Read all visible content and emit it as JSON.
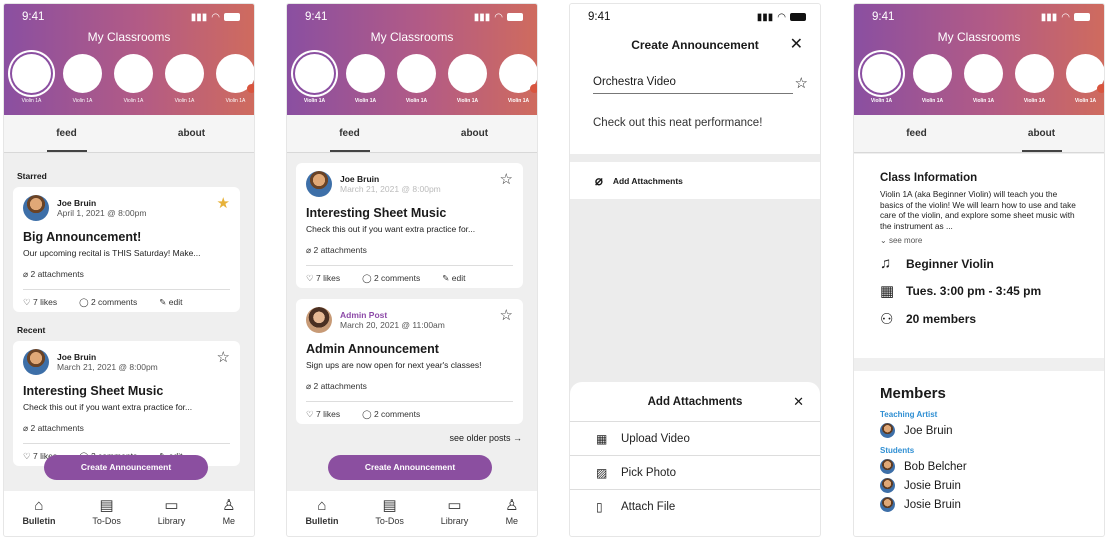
{
  "status": {
    "time": "9:41",
    "signal": ".ııl",
    "wifi": "≋"
  },
  "header": {
    "title": "My Classrooms",
    "class_label": "Violin 1A"
  },
  "tabs": {
    "feed": "feed",
    "about": "about"
  },
  "screen1": {
    "starred_title": "Starred",
    "recent_title": "Recent",
    "post1": {
      "author": "Joe Bruin",
      "date": "April 1, 2021 @ 8:00pm",
      "title": "Big Announcement!",
      "body": "Our upcoming recital is THIS Saturday! Make...",
      "attachments": "2 attachments",
      "likes": "7 likes",
      "comments": "2 comments",
      "edit": "edit"
    },
    "post2": {
      "author": "Joe Bruin",
      "date": "March 21, 2021 @ 8:00pm",
      "title": "Interesting Sheet Music",
      "body": "Check this out if you want extra practice for...",
      "attachments": "2 attachments",
      "likes": "7 likes",
      "comments": "2 comments",
      "edit": "edit"
    }
  },
  "screen2": {
    "post1": {
      "author": "Joe Bruin",
      "date": "March 21, 2021 @ 8:00pm",
      "title": "Interesting Sheet Music",
      "body": "Check this out if you want extra practice for...",
      "attachments": "2 attachments",
      "likes": "7 likes",
      "comments": "2 comments",
      "edit": "edit"
    },
    "post2": {
      "author": "Admin Post",
      "date": "March 20, 2021 @ 11:00am",
      "title": "Admin Announcement",
      "body": "Sign ups are now open for next year's classes!",
      "attachments": "2 attachments",
      "likes": "7 likes",
      "comments": "2 comments"
    },
    "older": "see older posts →"
  },
  "create_button": "Create Announcement",
  "nav": {
    "bulletin": "Bulletin",
    "todos": "To-Dos",
    "library": "Library",
    "me": "Me"
  },
  "screen3": {
    "title": "Create Announcement",
    "subject_value": "Orchestra Video",
    "message_value": "Check out this neat performance!",
    "add_attachments": "Add Attachments",
    "sheet_title": "Add Attachments",
    "upload_video": "Upload Video",
    "pick_photo": "Pick Photo",
    "attach_file": "Attach File"
  },
  "screen4": {
    "info_title": "Class Information",
    "info_body": "Violin 1A (aka Beginner Violin) will teach you the basics of the violin! We will learn how to use and take care of the violin, and explore some sheet music with the instrument as ...",
    "see_more": "see more",
    "course": "Beginner Violin",
    "schedule": "Tues. 3:00 pm - 3:45 pm",
    "members_count": "20 members",
    "members_title": "Members",
    "teaching_role": "Teaching Artist",
    "teacher": "Joe Bruin",
    "students_role": "Students",
    "students": [
      "Bob Belcher",
      "Josie Bruin",
      "Josie Bruin"
    ]
  }
}
